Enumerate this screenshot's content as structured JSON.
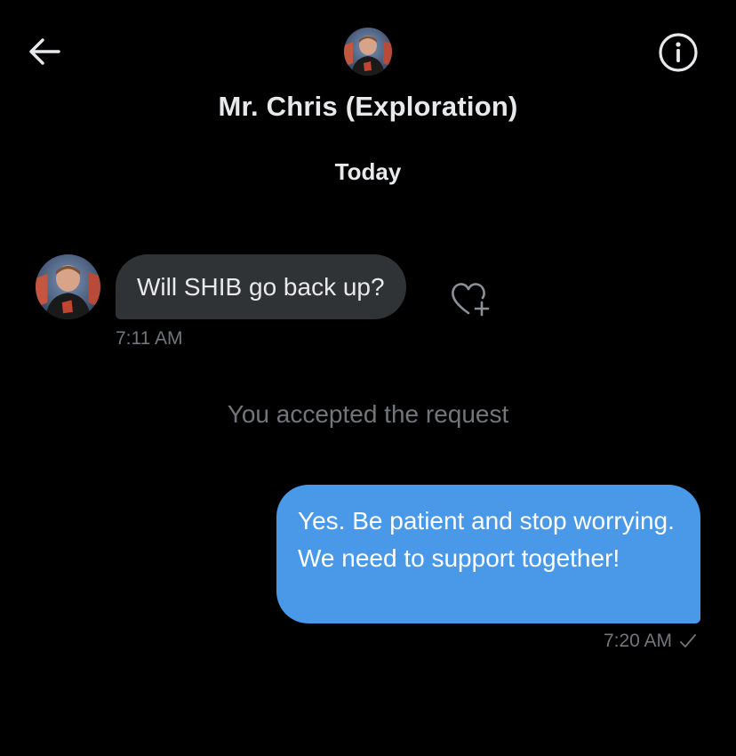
{
  "header": {
    "contact_name": "Mr. Chris (Exploration)",
    "back_icon": "arrow-left-icon",
    "info_icon": "info-circle-icon"
  },
  "conversation": {
    "date_divider": "Today",
    "messages": [
      {
        "direction": "incoming",
        "text": "Will SHIB go back up?",
        "time": "7:11 AM",
        "reaction_icon": "heart-plus-icon"
      },
      {
        "direction": "system",
        "text": "You accepted the request"
      },
      {
        "direction": "outgoing",
        "text": "Yes. Be patient and stop worrying. We need to support together!",
        "time": "7:20 AM",
        "status_icon": "checkmark-icon"
      }
    ]
  },
  "colors": {
    "background": "#000000",
    "incoming_bubble": "#2f3336",
    "outgoing_bubble": "#4a99e9",
    "muted_text": "#71767b",
    "primary_text": "#e7e9ea"
  }
}
